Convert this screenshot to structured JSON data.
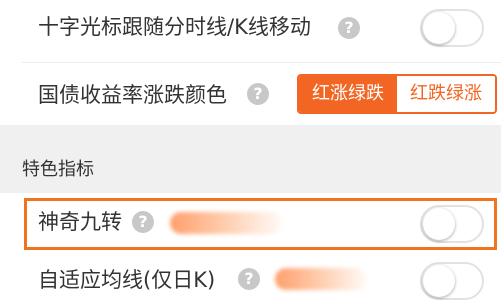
{
  "settings": {
    "crosshair": {
      "label": "十字光标跟随分时线/K线移动",
      "enabled": false
    },
    "bond_yield_color": {
      "label": "国债收益率涨跌颜色",
      "options": [
        "红涨绿跌",
        "红跌绿涨"
      ],
      "selected": "红涨绿跌"
    },
    "section_title": "特色指标",
    "magic_nine": {
      "label": "神奇九转",
      "enabled": false,
      "highlighted": true
    },
    "partial_row": {
      "label": "自适应均线(仅日K)",
      "enabled": false
    }
  },
  "colors": {
    "accent": "#f26522",
    "highlight_border": "#f0731e",
    "section_bg": "#f0f0f0",
    "help_icon": "#c8c8c8"
  },
  "icons": {
    "help": "help-icon",
    "help_glyph": "?"
  }
}
